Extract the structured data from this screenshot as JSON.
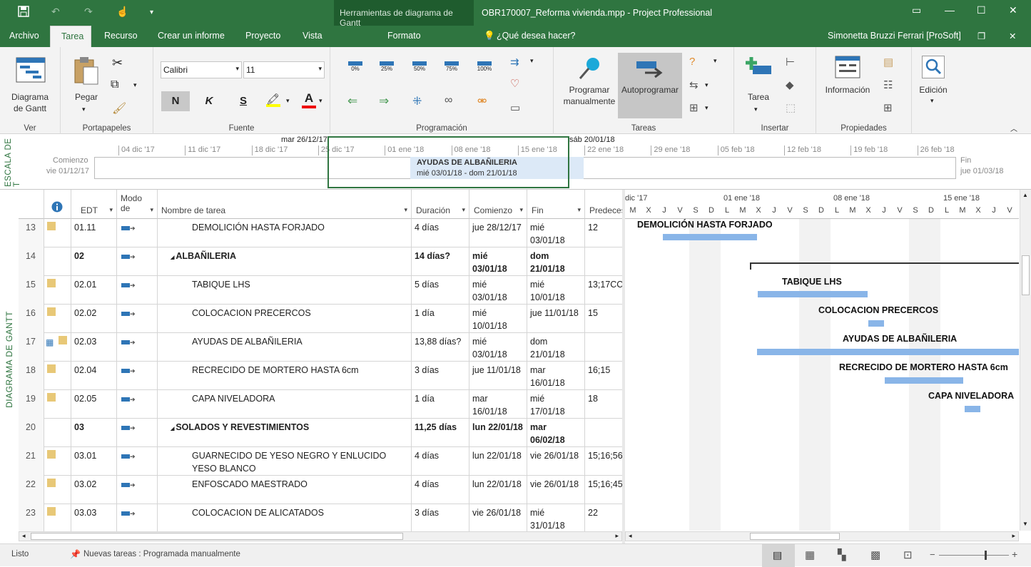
{
  "window": {
    "context_tab_header": "Herramientas de diagrama de Gantt",
    "title": "OBR170007_Reforma vivienda.mpp - Project Professional",
    "user": "Simonetta Bruzzi Ferrari [ProSoft]",
    "help_search": "¿Qué desea hacer?"
  },
  "tabs": [
    "Archivo",
    "Tarea",
    "Recurso",
    "Crear un informe",
    "Proyecto",
    "Vista",
    "Formato"
  ],
  "ribbon": {
    "ver": {
      "button": "Diagrama\nde Gantt",
      "label": "Ver"
    },
    "portapapeles": {
      "paste": "Pegar",
      "label": "Portapapeles"
    },
    "fuente": {
      "font": "Calibri",
      "size": "11",
      "bold": "N",
      "italic": "K",
      "strike": "S",
      "label": "Fuente"
    },
    "programacion": {
      "pcts": [
        "0%",
        "25%",
        "50%",
        "75%",
        "100%"
      ],
      "label": "Programación"
    },
    "tareas": {
      "manual": "Programar\nmanualmente",
      "auto": "Autoprogramar",
      "label": "Tareas"
    },
    "insertar": {
      "task": "Tarea",
      "label": "Insertar"
    },
    "propiedades": {
      "info": "Información",
      "label": "Propiedades"
    },
    "edicion": {
      "label": "Edición"
    }
  },
  "timeline": {
    "side_label": "ESCALA DE T",
    "start_label": "Comienzo",
    "start_date": "vie 01/12/17",
    "end_label": "Fin",
    "end_date": "jue 01/03/18",
    "view_start": "mar 26/12/17",
    "view_end": "sáb 20/01/18",
    "ticks": [
      "04 dic '17",
      "11 dic '17",
      "18 dic '17",
      "25 dic '17",
      "01 ene '18",
      "08 ene '18",
      "15 ene '18",
      "22 ene '18",
      "29 ene '18",
      "05 feb '18",
      "12 feb '18",
      "19 feb '18",
      "26 feb '18"
    ],
    "task_name": "AYUDAS DE ALBAÑILERIA",
    "task_dates": "mié 03/01/18 - dom 21/01/18"
  },
  "side_view_label": "DIAGRAMA DE GANTT",
  "table": {
    "headers": {
      "edt": "EDT",
      "mode": "Modo de",
      "name": "Nombre de tarea",
      "duration": "Duración",
      "start": "Comienzo",
      "finish": "Fin",
      "pred": "Predeces"
    },
    "rows": [
      {
        "id": "13",
        "edt": "01.11",
        "name": "DEMOLICIÓN HASTA FORJADO",
        "dur": "4 días",
        "start": "jue 28/12/17",
        "finish": "mié 03/01/18",
        "pred": "12",
        "summary": false
      },
      {
        "id": "14",
        "edt": "02",
        "name": "ALBAÑILERIA",
        "dur": "14 días?",
        "start": "mié 03/01/18",
        "finish": "dom 21/01/18",
        "pred": "",
        "summary": true
      },
      {
        "id": "15",
        "edt": "02.01",
        "name": "TABIQUE LHS",
        "dur": "5 días",
        "start": "mié 03/01/18",
        "finish": "mié 10/01/18",
        "pred": "13;17CC",
        "summary": false
      },
      {
        "id": "16",
        "edt": "02.02",
        "name": "COLOCACION PRECERCOS",
        "dur": "1 día",
        "start": "mié 10/01/18",
        "finish": "jue 11/01/18",
        "pred": "15",
        "summary": false
      },
      {
        "id": "17",
        "edt": "02.03",
        "name": "AYUDAS DE ALBAÑILERIA",
        "dur": "13,88 días?",
        "start": "mié 03/01/18",
        "finish": "dom 21/01/18",
        "pred": "",
        "summary": false
      },
      {
        "id": "18",
        "edt": "02.04",
        "name": "RECRECIDO DE MORTERO HASTA 6cm",
        "dur": "3 días",
        "start": "jue 11/01/18",
        "finish": "mar 16/01/18",
        "pred": "16;15",
        "summary": false
      },
      {
        "id": "19",
        "edt": "02.05",
        "name": "CAPA NIVELADORA",
        "dur": "1 día",
        "start": "mar 16/01/18",
        "finish": "mié 17/01/18",
        "pred": "18",
        "summary": false
      },
      {
        "id": "20",
        "edt": "03",
        "name": "SOLADOS Y REVESTIMIENTOS",
        "dur": "11,25 días",
        "start": "lun 22/01/18",
        "finish": "mar 06/02/18",
        "pred": "",
        "summary": true
      },
      {
        "id": "21",
        "edt": "03.01",
        "name": "GUARNECIDO DE YESO NEGRO Y ENLUCIDO YESO BLANCO",
        "dur": "4 días",
        "start": "lun 22/01/18",
        "finish": "vie 26/01/18",
        "pred": "15;16;56",
        "summary": false
      },
      {
        "id": "22",
        "edt": "03.02",
        "name": "ENFOSCADO MAESTRADO",
        "dur": "4 días",
        "start": "lun 22/01/18",
        "finish": "vie 26/01/18",
        "pred": "15;16;45",
        "summary": false
      },
      {
        "id": "23",
        "edt": "03.03",
        "name": "COLOCACION DE ALICATADOS",
        "dur": "3 días",
        "start": "vie 26/01/18",
        "finish": "mié 31/01/18",
        "pred": "22",
        "summary": false
      }
    ]
  },
  "gantt": {
    "top_labels": [
      "dic '17",
      "01 ene '18",
      "08 ene '18",
      "15 ene '18"
    ],
    "days": [
      "M",
      "X",
      "J",
      "V",
      "S",
      "D",
      "L",
      "M",
      "X",
      "J",
      "V",
      "S",
      "D",
      "L",
      "M",
      "X",
      "J",
      "V",
      "S",
      "D",
      "L",
      "M",
      "X",
      "J",
      "V"
    ],
    "bar_labels": [
      "DEMOLICIÓN HASTA FORJADO",
      "TABIQUE LHS",
      "COLOCACION PRECERCOS",
      "AYUDAS DE ALBAÑILERIA",
      "RECRECIDO DE MORTERO HASTA 6cm",
      "CAPA NIVELADORA"
    ]
  },
  "status": {
    "ready": "Listo",
    "new_tasks": "Nuevas tareas : Programada manualmente"
  },
  "colors": {
    "accent": "#2f7540",
    "bar": "#89b5e8"
  }
}
